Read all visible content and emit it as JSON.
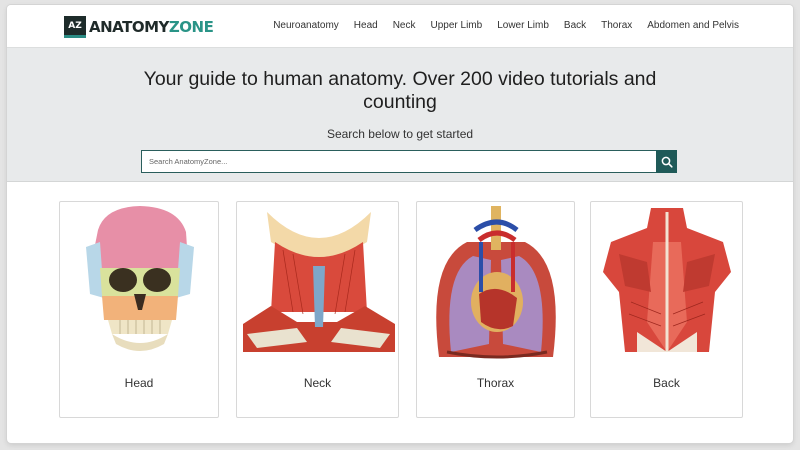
{
  "brand": {
    "mark": "AZ",
    "name_part1": "ANATOMY",
    "name_part2": "ZONE"
  },
  "nav": {
    "items": [
      "Neuroanatomy",
      "Head",
      "Neck",
      "Upper Limb",
      "Lower Limb",
      "Back",
      "Thorax",
      "Abdomen and Pelvis"
    ]
  },
  "hero": {
    "title": "Your guide to human anatomy. Over 200 video tutorials and counting",
    "subtitle": "Search below to get started",
    "search_placeholder": "Search AnatomyZone..."
  },
  "cards": [
    {
      "label": "Head"
    },
    {
      "label": "Neck"
    },
    {
      "label": "Thorax"
    },
    {
      "label": "Back"
    }
  ],
  "colors": {
    "brand_teal": "#2a9487",
    "search_button": "#1f5a58",
    "hero_bg": "#e8eaeb"
  },
  "icons": {
    "search": "search-icon"
  }
}
